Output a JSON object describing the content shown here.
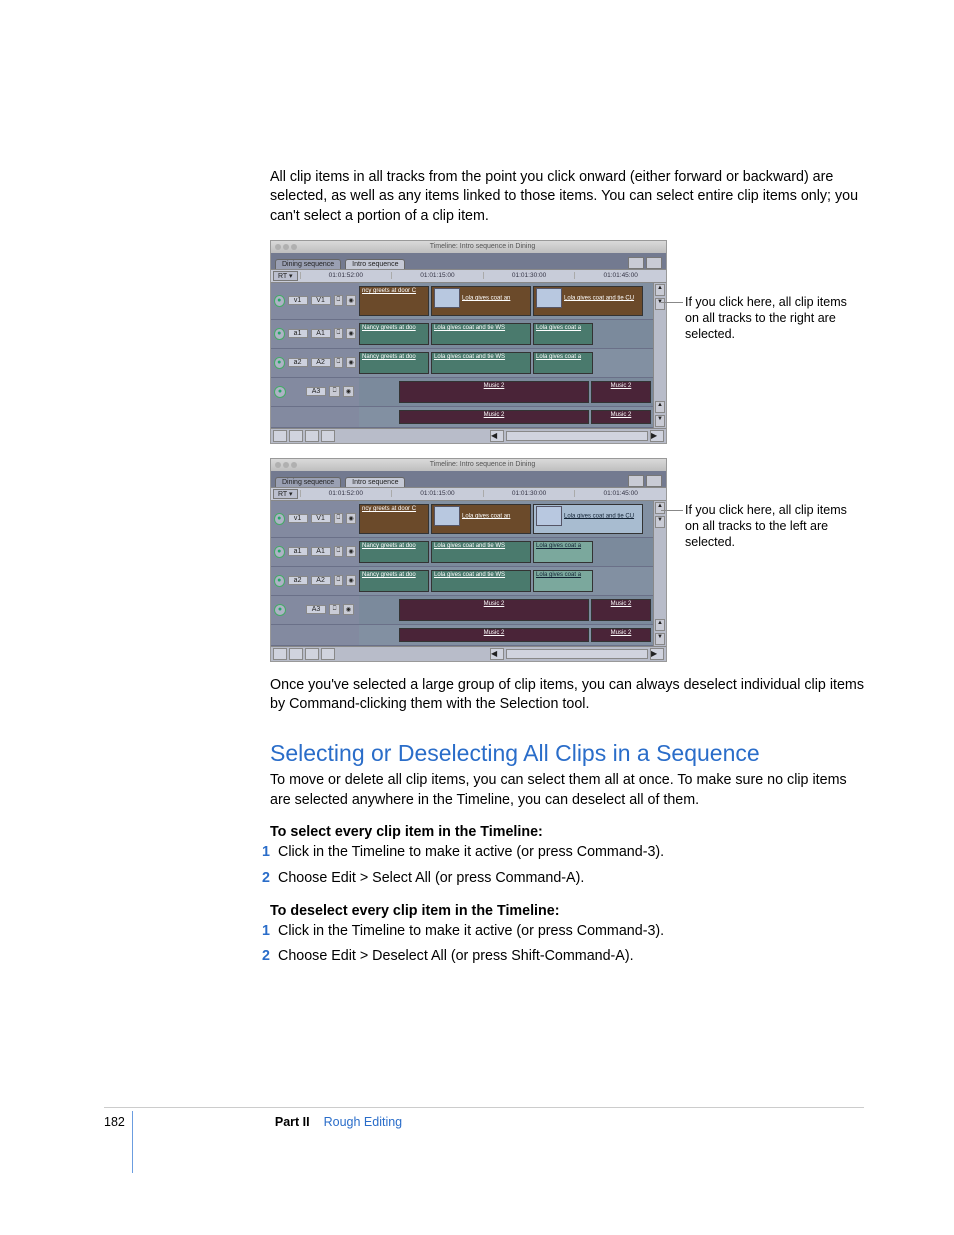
{
  "paragraphs": {
    "intro": "All clip items in all tracks from the point you click onward (either forward or backward) are selected, as well as any items linked to those items. You can select entire clip items only; you can't select a portion of a clip item.",
    "after_figures": "Once you've selected a large group of clip items, you can always deselect individual clip items by Command-clicking them with the Selection tool.",
    "section_heading": "Selecting or Deselecting All Clips in a Sequence",
    "section_para": "To move or delete all clip items, you can select them all at once. To make sure no clip items are selected anywhere in the Timeline, you can deselect all of them.",
    "select_heading": "To select every clip item in the Timeline:",
    "select_step1": "Click in the Timeline to make it active (or press Command-3).",
    "select_step2": "Choose Edit > Select All (or press Command-A).",
    "deselect_heading": "To deselect every clip item in the Timeline:",
    "deselect_step1": "Click in the Timeline to make it active (or press Command-3).",
    "deselect_step2": "Choose Edit > Deselect All (or press Shift-Command-A)."
  },
  "callouts": {
    "right": "If you click here, all clip items on all tracks to the right are selected.",
    "left": "If you click here, all clip items on all tracks to the left are selected."
  },
  "timeline": {
    "window_title": "Timeline: Intro sequence in Dining",
    "tab1": "Dining sequence",
    "tab2": "Intro sequence",
    "rt_label": "RT ▾",
    "timecode": "01:01:52:00",
    "ruler": [
      "01:01:15:00",
      "01:01:30:00",
      "01:01:45:00"
    ],
    "tracks": {
      "v1": {
        "src": "v1",
        "dst": "V1"
      },
      "a1": {
        "src": "a1",
        "dst": "A1"
      },
      "a2": {
        "src": "a2",
        "dst": "A2"
      },
      "a3": {
        "src": "",
        "dst": "A3"
      }
    },
    "clips": {
      "v_nancy": "ncy greets at door C",
      "v_lola_coat": "Lola gives coat an",
      "v_lola_cu": "Lola gives coat and tie CU",
      "a_nancy": "Nancy greets at doo",
      "a_lola_ws": "Lola gives coat and tie WS",
      "a_lola_coat": "Lola gives coat a",
      "music": "Music 2"
    }
  },
  "footer": {
    "page": "182",
    "part": "Part II",
    "chapter": "Rough Editing"
  },
  "step_numbers": {
    "one": "1",
    "two": "2"
  }
}
